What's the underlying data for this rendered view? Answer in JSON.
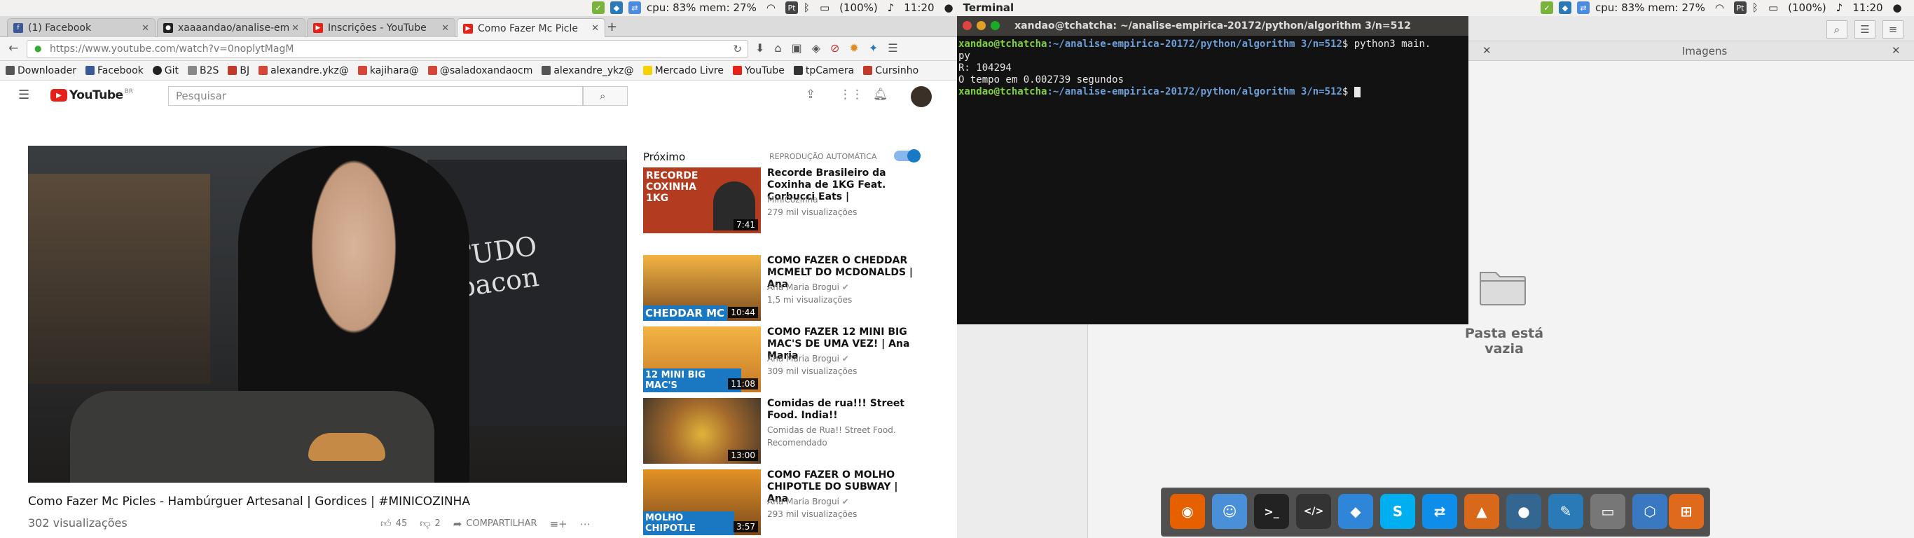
{
  "topbar": {
    "cpu_mem": "cpu: 83% mem: 27%",
    "pt": "Pt",
    "battery": "(100%)",
    "time": "11:20",
    "terminal_label": "Terminal"
  },
  "browser": {
    "tabs": [
      {
        "label": "(1) Facebook",
        "icon": "facebook-icon",
        "color": "#3b5998"
      },
      {
        "label": "xaaaandao/analise-em",
        "icon": "github-icon",
        "color": "#222222"
      },
      {
        "label": "Inscrições - YouTube",
        "icon": "youtube-icon",
        "color": "#e62117"
      },
      {
        "label": "Como Fazer Mc Picle",
        "icon": "youtube-icon",
        "color": "#e62117"
      }
    ],
    "url": "https://www.youtube.com/watch?v=0noplytMagM",
    "bookmarks": [
      {
        "label": "Downloader",
        "color": "#555555"
      },
      {
        "label": "Facebook",
        "color": "#3b5998"
      },
      {
        "label": "Git",
        "color": "#222222"
      },
      {
        "label": "B2S",
        "color": "#888888"
      },
      {
        "label": "BJ",
        "color": "#c0392b"
      },
      {
        "label": "alexandre.ykz@",
        "color": "#d44638"
      },
      {
        "label": "kajihara@",
        "color": "#d44638"
      },
      {
        "label": "@saladoxandaocm",
        "color": "#d44638"
      },
      {
        "label": "alexandre_ykz@",
        "color": "#555555"
      },
      {
        "label": "Mercado Livre",
        "color": "#f5d200"
      },
      {
        "label": "YouTube",
        "color": "#e62117"
      },
      {
        "label": "tpCamera",
        "color": "#333333"
      },
      {
        "label": "Cursinho",
        "color": "#c0392b"
      }
    ]
  },
  "youtube": {
    "logo": "YouTube",
    "logo_suffix": "BR",
    "search_placeholder": "Pesquisar",
    "video_title": "Como Fazer Mc Picles - Hambúrguer Artesanal | Gordices | #MINICOZINHA",
    "views": "302 visualizações",
    "likes": "45",
    "dislikes": "2",
    "share": "COMPARTILHAR",
    "next_label": "Próximo",
    "autoplay_label": "REPRODUÇÃO AUTOMÁTICA",
    "recommendations": [
      {
        "title": "Recorde Brasileiro da Coxinha de 1KG Feat. Corbucci Eats |",
        "channel": "MiniCozinha",
        "views": "279 mil visualizações",
        "duration": "7:41",
        "thumb_text": "RECORDE COXINHA 1KG",
        "thumb_color": "#b33b20"
      },
      {
        "title": "COMO FAZER O CHEDDAR MCMELT DO MCDONALDS | Ana",
        "channel": "Ana Maria Brogui",
        "views": "1,5 mi visualizações",
        "duration": "10:44",
        "thumb_text": "CHEDDAR MC",
        "thumb_color": "#f0a020"
      },
      {
        "title": "COMO FAZER 12 MINI BIG MAC'S DE UMA VEZ! | Ana Maria",
        "channel": "Ana Maria Brogui",
        "views": "309 mil visualizações",
        "duration": "11:08",
        "thumb_text": "12 MINI BIG MAC'S",
        "thumb_color": "#e89a2a"
      },
      {
        "title": "Comidas de rua!!! Street Food. India!!",
        "channel": "Comidas de Rua!! Street Food.",
        "views": "Recomendado",
        "duration": "13:00",
        "thumb_text": "",
        "thumb_color": "#8a5a2a"
      },
      {
        "title": "COMO FAZER O MOLHO CHIPOTLE DO SUBWAY | Ana",
        "channel": "Ana Maria Brogui",
        "views": "293 mil visualizações",
        "duration": "3:57",
        "thumb_text": "MOLHO CHIPOTLE",
        "thumb_color": "#e39224"
      }
    ]
  },
  "terminal": {
    "title": "xandao@tchatcha: ~/analise-empirica-20172/python/algorithm 3/n=512",
    "user": "xandao@tchatcha",
    "path": ":~/analise-empirica-20172/python/algorithm 3/n=512",
    "command": "$ python3 main.",
    "command_cont": "py",
    "output1": "R: 104294",
    "output2": "O tempo em 0.002739 segundos",
    "prompt_end": "$"
  },
  "files": {
    "header": "Imagens",
    "empty_text": "Pasta está vazia"
  },
  "dock": [
    {
      "name": "firefox-icon",
      "color": "#e66000",
      "glyph": "◉"
    },
    {
      "name": "finder-icon",
      "color": "#4a90d9",
      "glyph": "☺"
    },
    {
      "name": "terminal-icon",
      "color": "#222222",
      "glyph": ">_"
    },
    {
      "name": "code-editor-icon",
      "color": "#333333",
      "glyph": "</>"
    },
    {
      "name": "dropbox-icon",
      "color": "#2f86d9",
      "glyph": "◆"
    },
    {
      "name": "skype-icon",
      "color": "#00aff0",
      "glyph": "S"
    },
    {
      "name": "teamviewer-icon",
      "color": "#0e8ee9",
      "glyph": "⇄"
    },
    {
      "name": "matlab-icon",
      "color": "#d9691a",
      "glyph": "▲"
    },
    {
      "name": "postgres-icon",
      "color": "#336791",
      "glyph": "🐘"
    },
    {
      "name": "mysql-workbench-icon",
      "color": "#2a7ab8",
      "glyph": "✎"
    },
    {
      "name": "disk-icon",
      "color": "#777777",
      "glyph": "▭"
    },
    {
      "name": "virtualbox-icon",
      "color": "#3a78c2",
      "glyph": "⬡"
    },
    {
      "name": "package-icon",
      "color": "#e06a1c",
      "glyph": "⊞"
    }
  ]
}
